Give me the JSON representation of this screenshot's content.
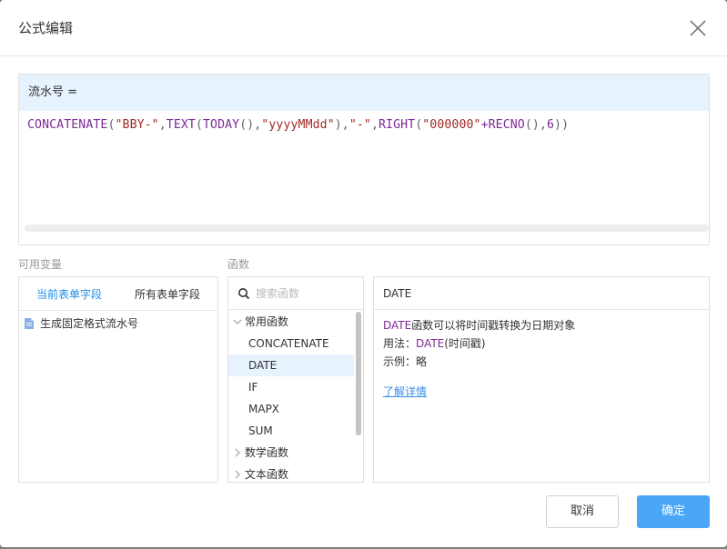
{
  "dialog": {
    "title": "公式编辑"
  },
  "editor": {
    "field_label": "流水号 =",
    "formula": "CONCATENATE(\"BBY-\",TEXT(TODAY(),\"yyyyMMdd\"),\"-\",RIGHT(\"000000\"+RECNO(),6))"
  },
  "variables": {
    "section_label": "可用变量",
    "tabs": [
      "当前表单字段",
      "所有表单字段"
    ],
    "active_tab": 0,
    "items": [
      "生成固定格式流水号"
    ]
  },
  "functions": {
    "section_label": "函数",
    "search_placeholder": "搜索函数",
    "groups": [
      {
        "name": "常用函数",
        "expanded": true,
        "items": [
          "CONCATENATE",
          "DATE",
          "IF",
          "MAPX",
          "SUM"
        ]
      },
      {
        "name": "数学函数",
        "expanded": false
      },
      {
        "name": "文本函数",
        "expanded": false
      }
    ],
    "selected": "DATE"
  },
  "detail": {
    "title": "DATE",
    "description_kw": "DATE",
    "description_rest": "函数可以将时间戳转换为日期对象",
    "usage_prefix": "用法：",
    "usage_kw": "DATE",
    "usage_rest": "(时间戳)",
    "example": "示例：略",
    "learn_more": "了解详情"
  },
  "buttons": {
    "cancel": "取消",
    "ok": "确定"
  },
  "colors": {
    "accent": "#4ba6f8",
    "function_keyword": "#7c2a96",
    "string_literal": "#a22925",
    "header_bg": "#e6f2fd"
  }
}
